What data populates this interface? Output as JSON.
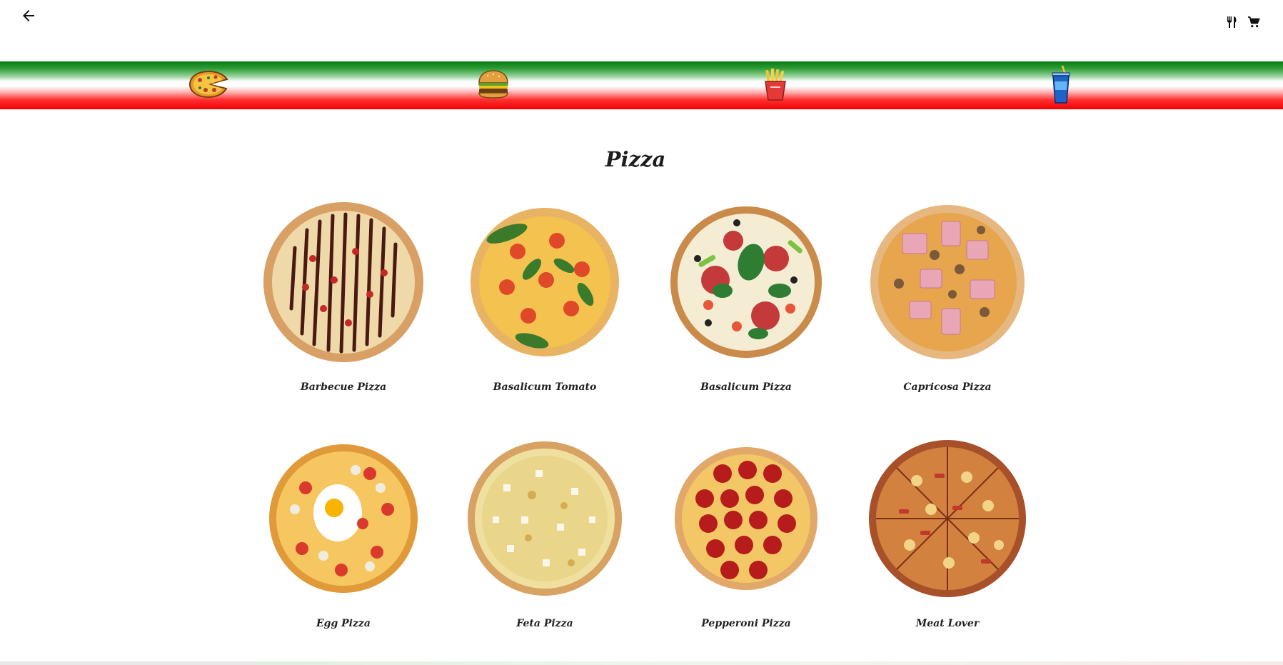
{
  "header": {
    "back_icon": "arrow-left-icon",
    "actions": [
      {
        "name": "menu",
        "icon": "fork-knife-icon"
      },
      {
        "name": "cart",
        "icon": "shopping-cart-icon"
      }
    ]
  },
  "categories": [
    {
      "name": "pizza",
      "icon": "pizza-icon"
    },
    {
      "name": "burger",
      "icon": "burger-icon"
    },
    {
      "name": "fries",
      "icon": "fries-icon"
    },
    {
      "name": "drink",
      "icon": "soda-cup-icon"
    }
  ],
  "colors": {
    "band_green": "#0a7a14",
    "band_white": "#ffffff",
    "band_red": "#f00000",
    "text": "#1d1d1d"
  },
  "section": {
    "title": "Pizza"
  },
  "products": [
    {
      "name": "Barbecue Pizza",
      "topping": "bbq"
    },
    {
      "name": "Basalicum Tomato",
      "topping": "tomato-basil"
    },
    {
      "name": "Basalicum Pizza",
      "topping": "salami-basil"
    },
    {
      "name": "Capricosa Pizza",
      "topping": "ham-mushroom"
    },
    {
      "name": "Egg Pizza",
      "topping": "egg"
    },
    {
      "name": "Feta Pizza",
      "topping": "feta"
    },
    {
      "name": "Pepperoni Pizza",
      "topping": "pepperoni"
    },
    {
      "name": "Meat Lover",
      "topping": "meat"
    }
  ]
}
